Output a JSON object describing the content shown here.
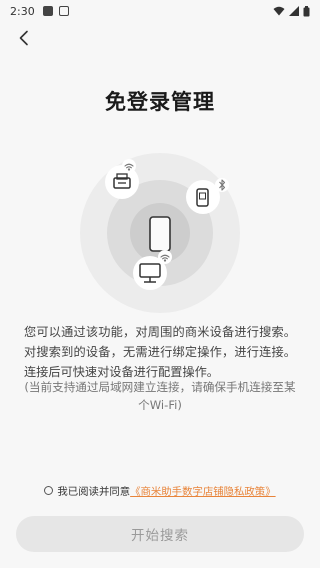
{
  "status_bar": {
    "time": "2:30"
  },
  "header": {
    "title": "免登录管理"
  },
  "main": {
    "description": "您可以通过该功能，对周围的商米设备进行搜索。对搜索到的设备，无需进行绑定操作，进行连接。连接后可快速对设备进行配置操作。",
    "note": "(当前支持通过局域网建立连接，请确保手机连接至某个Wi-Fi)"
  },
  "agreement": {
    "prefix": "我已阅读并同意",
    "policy_link": "《商米助手数字店铺隐私政策》"
  },
  "actions": {
    "start_search": "开始搜索"
  },
  "colors": {
    "accent": "#e8843a",
    "button_disabled_bg": "#e6e6e6",
    "button_disabled_text": "#9a9a9a"
  },
  "icons": [
    "back-arrow-icon",
    "wifi-icon",
    "bluetooth-icon",
    "phone-icon",
    "printer-icon",
    "monitor-icon",
    "scanner-icon"
  ]
}
